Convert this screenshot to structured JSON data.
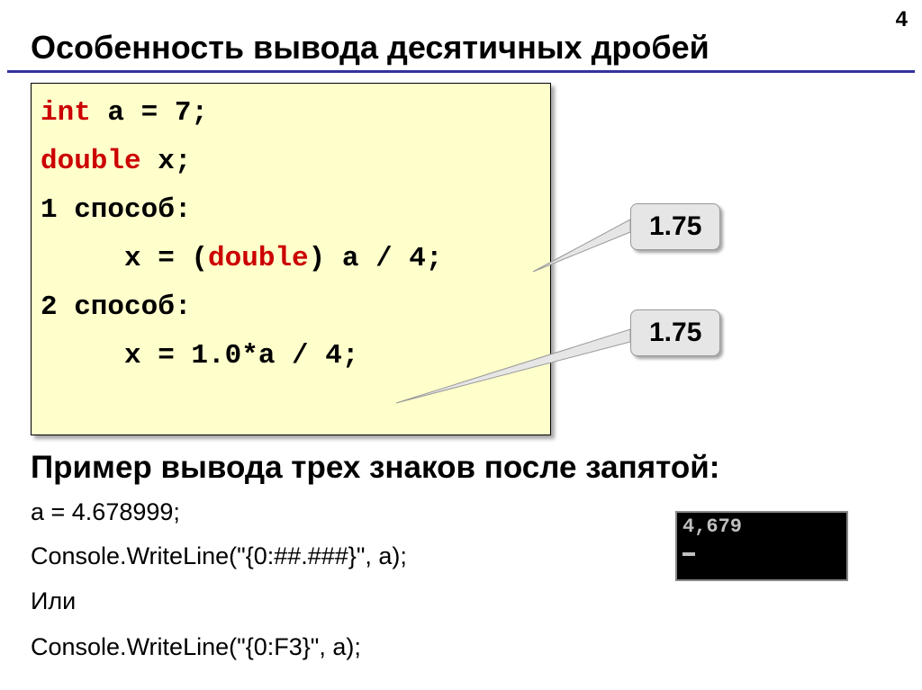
{
  "pageNumber": "4",
  "title": "Особенность вывода десятичных дробей",
  "code": {
    "line1a": "int",
    "line1b": " a = 7;",
    "line2a": "double",
    "line2b": " x;",
    "line3": "1 способ:",
    "line4a": "     x = (",
    "line4b": "double",
    "line4c": ") a / 4;",
    "line5": "2 способ:",
    "line6": "     x = 1.0*a / 4;"
  },
  "callouts": {
    "c1": "1.75",
    "c2": "1.75"
  },
  "subheading": "Пример вывода трех знаков после запятой:",
  "lines": {
    "l1": "a = 4.678999;",
    "l2": "Console.WriteLine(\"{0:##.###}\", a);",
    "l3": "Или",
    "l4": "Console.WriteLine(\"{0:F3}\", a);"
  },
  "console": {
    "output": "4,679"
  }
}
